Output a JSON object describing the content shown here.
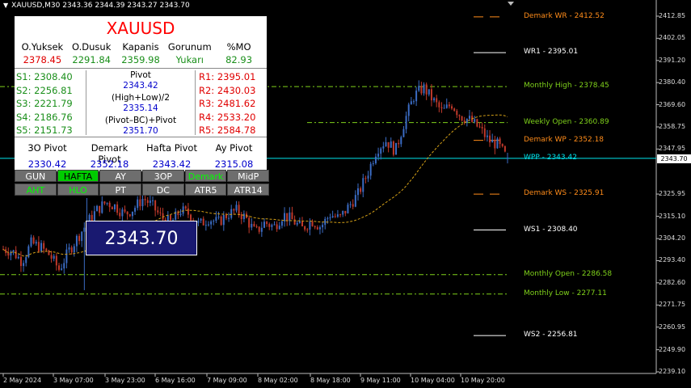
{
  "header": {
    "symbol_line": "XAUUSD,M30  2343.36 2344.39 2343.27 2343.70"
  },
  "panel": {
    "title": "XAUUSD",
    "quote_headers": [
      "O.Yuksek",
      "O.Dusuk",
      "Kapanis",
      "Gorunum",
      "%MO"
    ],
    "quote_values": [
      "2378.45",
      "2291.84",
      "2359.98",
      "Yukarı",
      "82.93"
    ],
    "supports": [
      "S1: 2308.40",
      "S2: 2256.81",
      "S3: 2221.79",
      "S4: 2186.76",
      "S5: 2151.73"
    ],
    "resistances": [
      "R1: 2395.01",
      "R2: 2430.03",
      "R3: 2481.62",
      "R4: 2533.20",
      "R5: 2584.78"
    ],
    "pivot_label": "Pivot",
    "pivot_value": "2343.42",
    "hl2_label": "(High+Low)/2",
    "hl2_value": "2335.14",
    "pbc_label": "(Pivot–BC)+Pivot",
    "pbc_value": "2351.70",
    "pivot_headers": [
      "3O Pivot",
      "Demark Pivot",
      "Hafta Pivot",
      "Ay Pivot"
    ],
    "pivot_values": [
      "2330.42",
      "2352.18",
      "2343.42",
      "2315.08"
    ]
  },
  "buttons": {
    "row1": [
      "GUN",
      "HAFTA",
      "AY",
      "3OP",
      "Demark",
      "MidP"
    ],
    "row2": [
      "AHT",
      "HLO",
      "PT",
      "DC",
      "ATR5",
      "ATR14"
    ]
  },
  "current_price_box": "2343.70",
  "current_price_tag": "2343.70",
  "levels": [
    {
      "label": "Demark WR - 2412.52",
      "color": "#ff8c1a"
    },
    {
      "label": "WR1 - 2395.01",
      "color": "#ffffff"
    },
    {
      "label": "Monthly High - 2378.45",
      "color": "#7fd11b"
    },
    {
      "label": "Weekly Open - 2360.89",
      "color": "#7fd11b"
    },
    {
      "label": "Demark WP - 2352.18",
      "color": "#ff8c1a"
    },
    {
      "label": "WPP - 2343.42",
      "color": "#00e5ee"
    },
    {
      "label": "Demark WS - 2325.91",
      "color": "#ff8c1a"
    },
    {
      "label": "WS1 - 2308.40",
      "color": "#ffffff"
    },
    {
      "label": "Monthly Open - 2286.58",
      "color": "#7fd11b"
    },
    {
      "label": "Monthly Low - 2277.11",
      "color": "#7fd11b"
    },
    {
      "label": "WS2 - 2256.81",
      "color": "#ffffff"
    }
  ],
  "price_axis": [
    "2412.85",
    "2402.05",
    "2391.20",
    "2380.40",
    "2369.60",
    "2358.75",
    "2347.95",
    "2325.95",
    "2315.10",
    "2304.20",
    "2293.40",
    "2282.60",
    "2271.75",
    "2260.95",
    "2249.90",
    "2239.10"
  ],
  "time_axis": [
    "2 May 2024",
    "3 May 07:00",
    "3 May 23:00",
    "6 May 16:00",
    "7 May 09:00",
    "8 May 02:00",
    "8 May 18:00",
    "9 May 11:00",
    "10 May 04:00",
    "10 May 20:00"
  ],
  "chart_data": {
    "type": "candlestick",
    "symbol": "XAUUSD",
    "timeframe": "M30",
    "last": {
      "open": 2343.36,
      "high": 2344.39,
      "low": 2343.27,
      "close": 2343.7
    },
    "ylim": [
      2239.1,
      2418
    ],
    "price_scale": {
      "ref_price": 2402.05,
      "ref_y_price": 2391.2
    },
    "colors": {
      "up": "#3b6cc4",
      "down": "#c0392b",
      "ma": "#d4a017"
    },
    "anchors": [
      2299,
      2298,
      2293,
      2302,
      2300,
      2296,
      2289,
      2298,
      2305,
      2312,
      2318,
      2322,
      2320,
      2316,
      2319,
      2324,
      2320,
      2314,
      2312,
      2318,
      2316,
      2311,
      2314,
      2312,
      2316,
      2318,
      2314,
      2307,
      2312,
      2310,
      2316,
      2313,
      2309,
      2313,
      2310,
      2316,
      2314,
      2320,
      2326,
      2336,
      2348,
      2352,
      2347,
      2362,
      2374,
      2378,
      2372,
      2366,
      2370,
      2364,
      2362,
      2358,
      2352,
      2350,
      2343
    ]
  }
}
